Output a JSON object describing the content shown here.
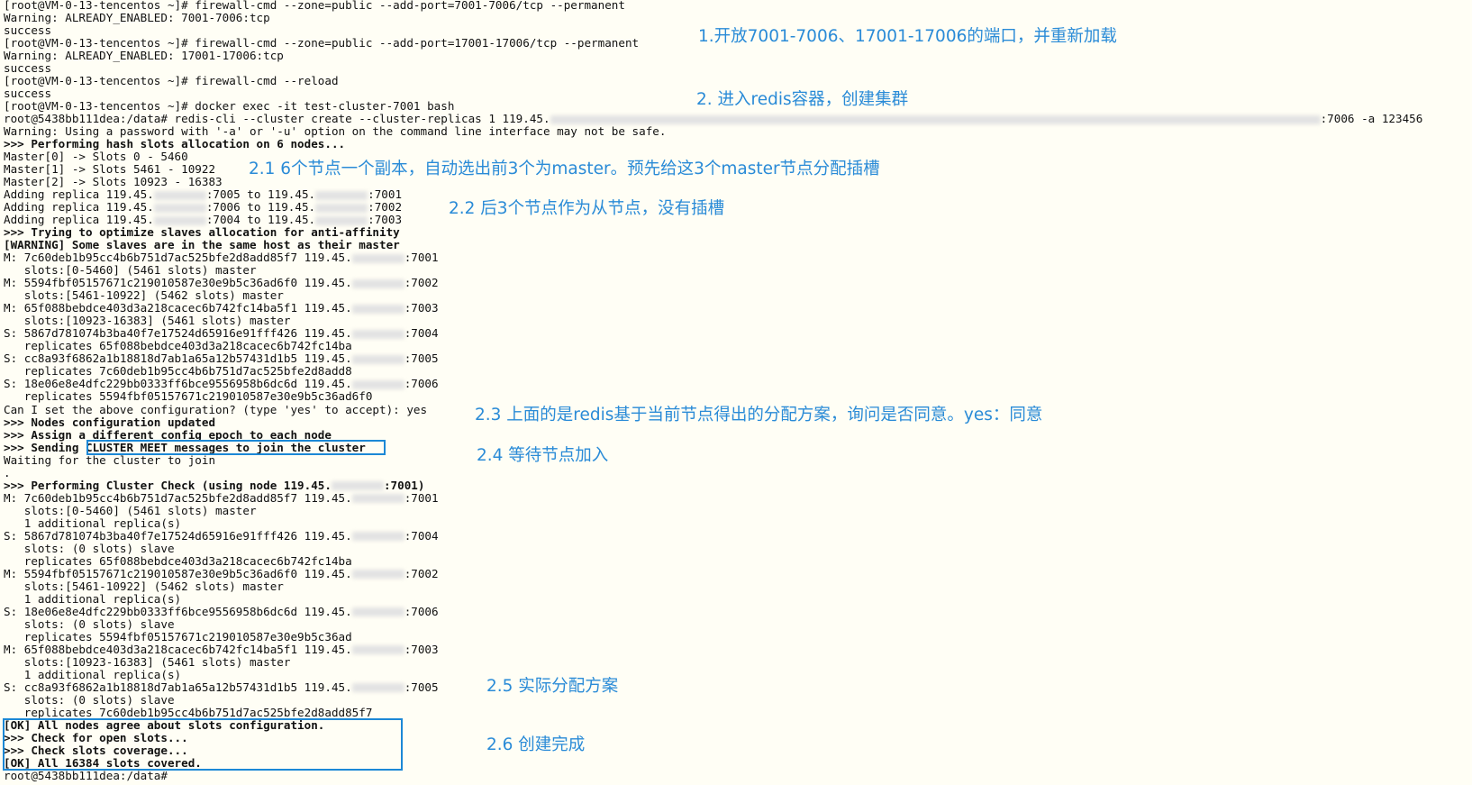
{
  "terminal": {
    "lines": [
      {
        "parts": [
          "[root@VM-0-13-tencentos ~]# firewall-cmd --zone=public --add-port=7001-7006/tcp --permanent"
        ]
      },
      {
        "parts": [
          "Warning: ALREADY_ENABLED: 7001-7006:tcp"
        ]
      },
      {
        "parts": [
          "success"
        ]
      },
      {
        "parts": [
          "[root@VM-0-13-tencentos ~]# firewall-cmd --zone=public --add-port=17001-17006/tcp --permanent"
        ]
      },
      {
        "parts": [
          "Warning: ALREADY_ENABLED: 17001-17006:tcp"
        ]
      },
      {
        "parts": [
          "success"
        ]
      },
      {
        "parts": [
          "[root@VM-0-13-tencentos ~]# firewall-cmd --reload"
        ]
      },
      {
        "parts": [
          "success"
        ]
      },
      {
        "parts": [
          "[root@VM-0-13-tencentos ~]# docker exec -it test-cluster-7001 bash"
        ]
      },
      {
        "parts": [
          "root@5438bb111dea:/data# redis-cli --cluster create --cluster-replicas 1 119.45.",
          ":7006 -a 123456"
        ],
        "long": true
      },
      {
        "parts": [
          "Warning: Using a password with '-a' or '-u' option on the command line interface may not be safe."
        ]
      },
      {
        "parts": [
          ">>> Performing hash slots allocation on 6 nodes..."
        ],
        "bold": true
      },
      {
        "parts": [
          "Master[0] -> Slots 0 - 5460"
        ]
      },
      {
        "parts": [
          "Master[1] -> Slots 5461 - 10922"
        ]
      },
      {
        "parts": [
          "Master[2] -> Slots 10923 - 16383"
        ]
      },
      {
        "parts": [
          "Adding replica 119.45.",
          ":7005 to 119.45.",
          ":7001"
        ]
      },
      {
        "parts": [
          "Adding replica 119.45.",
          ":7006 to 119.45.",
          ":7002"
        ]
      },
      {
        "parts": [
          "Adding replica 119.45.",
          ":7004 to 119.45.",
          ":7003"
        ]
      },
      {
        "parts": [
          ">>> Trying to optimize slaves allocation for anti-affinity"
        ],
        "bold": true
      },
      {
        "parts": [
          "[WARNING] Some slaves are in the same host as their master"
        ],
        "bold": true
      },
      {
        "parts": [
          "M: 7c60deb1b95cc4b6b751d7ac525bfe2d8add85f7 119.45.",
          ":7001"
        ]
      },
      {
        "parts": [
          "   slots:[0-5460] (5461 slots) master"
        ]
      },
      {
        "parts": [
          "M: 5594fbf05157671c219010587e30e9b5c36ad6f0 119.45.",
          ":7002"
        ]
      },
      {
        "parts": [
          "   slots:[5461-10922] (5462 slots) master"
        ]
      },
      {
        "parts": [
          "M: 65f088bebdce403d3a218cacec6b742fc14ba5f1 119.45.",
          ":7003"
        ]
      },
      {
        "parts": [
          "   slots:[10923-16383] (5461 slots) master"
        ]
      },
      {
        "parts": [
          "S: 5867d781074b3ba40f7e17524d65916e91fff426 119.45.",
          ":7004"
        ]
      },
      {
        "parts": [
          "   replicates 65f088bebdce403d3a218cacec6b742fc14ba"
        ]
      },
      {
        "parts": [
          "S: cc8a93f6862a1b18818d7ab1a65a12b57431d1b5 119.45.",
          ":7005"
        ]
      },
      {
        "parts": [
          "   replicates 7c60deb1b95cc4b6b751d7ac525bfe2d8add8"
        ]
      },
      {
        "parts": [
          "S: 18e06e8e4dfc229bb0333ff6bce9556958b6dc6d 119.45.",
          ":7006"
        ]
      },
      {
        "parts": [
          "   replicates 5594fbf05157671c219010587e30e9b5c36ad6f0"
        ]
      },
      {
        "parts": [
          "Can I set the above configuration? (type 'yes' to accept): yes"
        ]
      },
      {
        "parts": [
          ">>> Nodes configuration updated"
        ],
        "bold": true
      },
      {
        "parts": [
          ">>> Assign a different config epoch to each node"
        ],
        "bold": true
      },
      {
        "parts": [
          ">>> Sending CLUSTER MEET messages to join the cluster"
        ],
        "bold": true
      },
      {
        "parts": [
          "Waiting for the cluster to join"
        ]
      },
      {
        "parts": [
          "."
        ]
      },
      {
        "parts": [
          ">>> Performing Cluster Check (using node 119.45.",
          ":7001)"
        ],
        "bold": true
      },
      {
        "parts": [
          "M: 7c60deb1b95cc4b6b751d7ac525bfe2d8add85f7 119.45.",
          ":7001"
        ]
      },
      {
        "parts": [
          "   slots:[0-5460] (5461 slots) master"
        ]
      },
      {
        "parts": [
          "   1 additional replica(s)"
        ]
      },
      {
        "parts": [
          "S: 5867d781074b3ba40f7e17524d65916e91fff426 119.45.",
          ":7004"
        ]
      },
      {
        "parts": [
          "   slots: (0 slots) slave"
        ]
      },
      {
        "parts": [
          "   replicates 65f088bebdce403d3a218cacec6b742fc14ba"
        ]
      },
      {
        "parts": [
          "M: 5594fbf05157671c219010587e30e9b5c36ad6f0 119.45.",
          ":7002"
        ]
      },
      {
        "parts": [
          "   slots:[5461-10922] (5462 slots) master"
        ]
      },
      {
        "parts": [
          "   1 additional replica(s)"
        ]
      },
      {
        "parts": [
          "S: 18e06e8e4dfc229bb0333ff6bce9556958b6dc6d 119.45.",
          ":7006"
        ]
      },
      {
        "parts": [
          "   slots: (0 slots) slave"
        ]
      },
      {
        "parts": [
          "   replicates 5594fbf05157671c219010587e30e9b5c36ad"
        ]
      },
      {
        "parts": [
          "M: 65f088bebdce403d3a218cacec6b742fc14ba5f1 119.45.",
          ":7003"
        ]
      },
      {
        "parts": [
          "   slots:[10923-16383] (5461 slots) master"
        ]
      },
      {
        "parts": [
          "   1 additional replica(s)"
        ]
      },
      {
        "parts": [
          "S: cc8a93f6862a1b18818d7ab1a65a12b57431d1b5 119.45.",
          ":7005"
        ]
      },
      {
        "parts": [
          "   slots: (0 slots) slave"
        ]
      },
      {
        "parts": [
          "   replicates 7c60deb1b95cc4b6b751d7ac525bfe2d8add85f7"
        ]
      },
      {
        "parts": [
          "[OK] All nodes agree about slots configuration."
        ],
        "bold": true
      },
      {
        "parts": [
          ">>> Check for open slots..."
        ],
        "bold": true
      },
      {
        "parts": [
          ">>> Check slots coverage..."
        ],
        "bold": true
      },
      {
        "parts": [
          "[OK] All 16384 slots covered."
        ],
        "bold": true
      },
      {
        "parts": [
          "root@5438bb111dea:/data#"
        ]
      }
    ]
  },
  "annotations": {
    "open_ports": "1.开放7001-7006、17001-17006的端口，并重新加载",
    "enter_container": "2. 进入redis容器，创建集群",
    "allocation": "2.1 6个节点一个副本，自动选出前3个为master。预先给这3个master节点分配插槽",
    "replicas": "2.2 后3个节点作为从节点，没有插槽",
    "confirm": "2.3 上面的是redis基于当前节点得出的分配方案，询问是否同意。yes：同意",
    "wait_join": "2.4 等待节点加入",
    "actual_plan": "2.5 实际分配方案",
    "done": "2.6 创建完成"
  },
  "colors": {
    "annotation": "#2a8bd7",
    "highlight_box": "#1c88d6",
    "background": "#fffef5"
  }
}
